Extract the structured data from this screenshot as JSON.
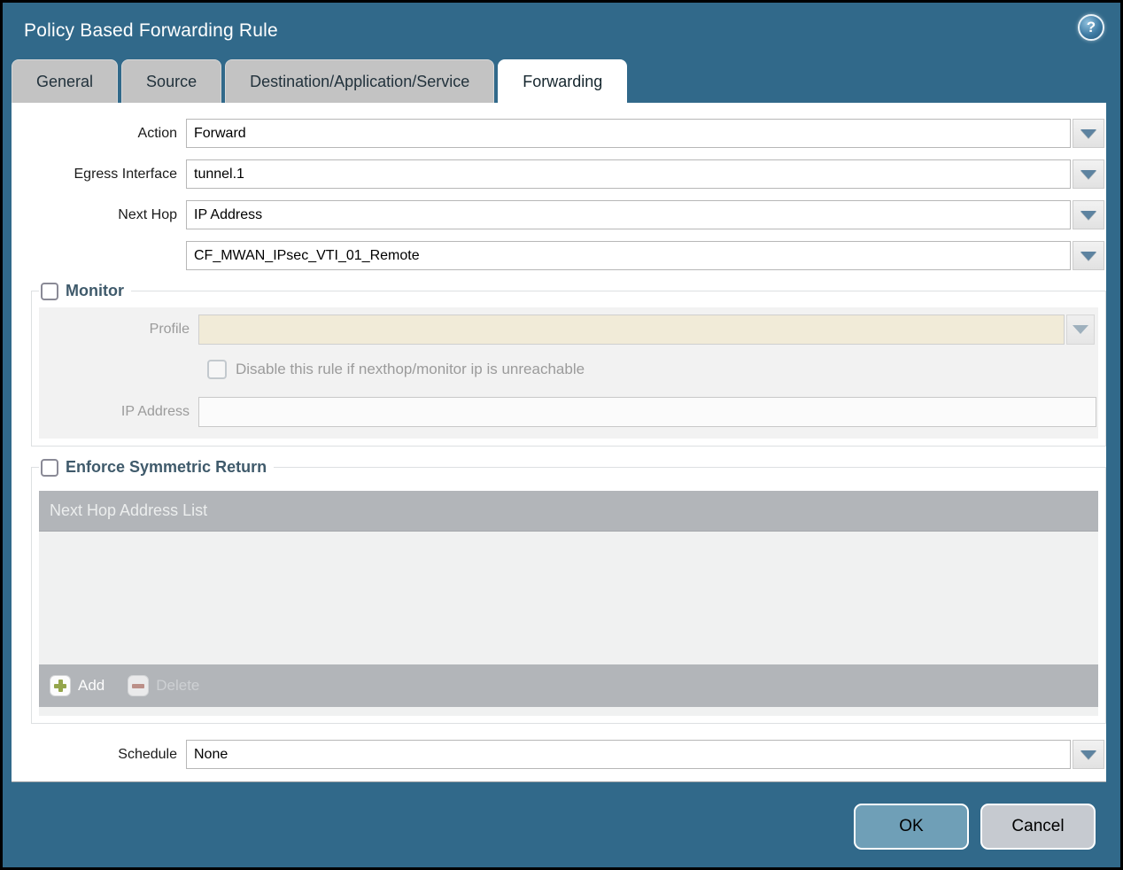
{
  "dialog": {
    "title": "Policy Based Forwarding Rule",
    "help_glyph": "?"
  },
  "tabs": [
    {
      "label": "General",
      "active": false
    },
    {
      "label": "Source",
      "active": false
    },
    {
      "label": "Destination/Application/Service",
      "active": false
    },
    {
      "label": "Forwarding",
      "active": true
    }
  ],
  "form": {
    "action": {
      "label": "Action",
      "value": "Forward"
    },
    "egress_interface": {
      "label": "Egress Interface",
      "value": "tunnel.1"
    },
    "next_hop": {
      "label": "Next Hop",
      "value": "IP Address"
    },
    "next_hop_address": {
      "value": "CF_MWAN_IPsec_VTI_01_Remote"
    },
    "schedule": {
      "label": "Schedule",
      "value": "None"
    }
  },
  "monitor": {
    "legend": "Monitor",
    "checked": false,
    "profile": {
      "label": "Profile",
      "value": ""
    },
    "disable_rule": {
      "label": "Disable this rule if nexthop/monitor ip is unreachable",
      "checked": false
    },
    "ip_address": {
      "label": "IP Address",
      "value": ""
    }
  },
  "symmetric_return": {
    "legend": "Enforce Symmetric Return",
    "checked": false,
    "table": {
      "header": "Next Hop Address List",
      "rows": []
    },
    "add_label": "Add",
    "delete_label": "Delete",
    "delete_enabled": false
  },
  "footer": {
    "ok_label": "OK",
    "cancel_label": "Cancel"
  },
  "colors": {
    "titlebar_teal": "#31698a",
    "active_tab": "#ffffff",
    "inactive_tab": "#c3c3c3",
    "legend_text": "#3f5a6b",
    "disabled_field_beige": "#f1ebd8",
    "table_gray": "#b2b5b9",
    "ok_button": "#6f9fb7",
    "cancel_button": "#c6cad0",
    "add_plus_green": "#94a54b",
    "delete_minus_rose": "#bb8f88",
    "dropdown_arrow": "#5d83a0"
  }
}
